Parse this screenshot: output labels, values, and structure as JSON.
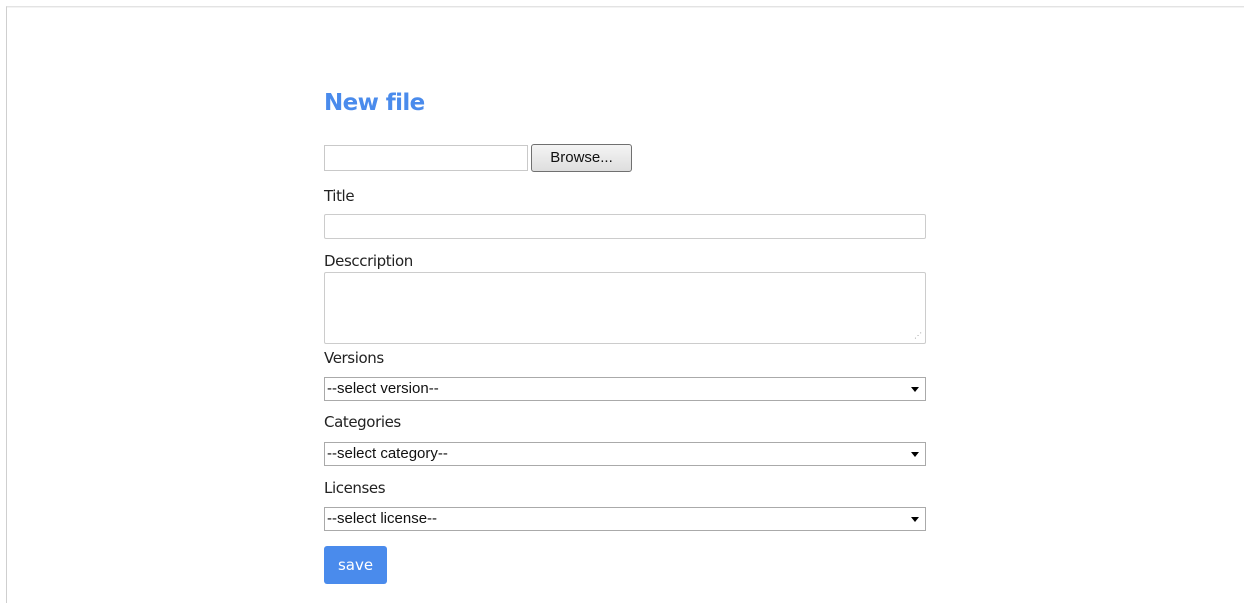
{
  "page": {
    "title": "New file"
  },
  "file_upload": {
    "path_value": "",
    "browse_label": "Browse..."
  },
  "fields": {
    "title_label": "Title",
    "title_value": "",
    "description_label": "Desccription",
    "description_value": "",
    "versions_label": "Versions",
    "versions_selected": "--select version--",
    "categories_label": "Categories",
    "categories_selected": "--select category--",
    "licenses_label": "Licenses",
    "licenses_selected": "--select license--"
  },
  "actions": {
    "save_label": "save"
  },
  "colors": {
    "accent": "#4a8bec"
  },
  "icons": {
    "dropdown": "chevron-down-icon",
    "resize": "resize-grip-icon"
  }
}
